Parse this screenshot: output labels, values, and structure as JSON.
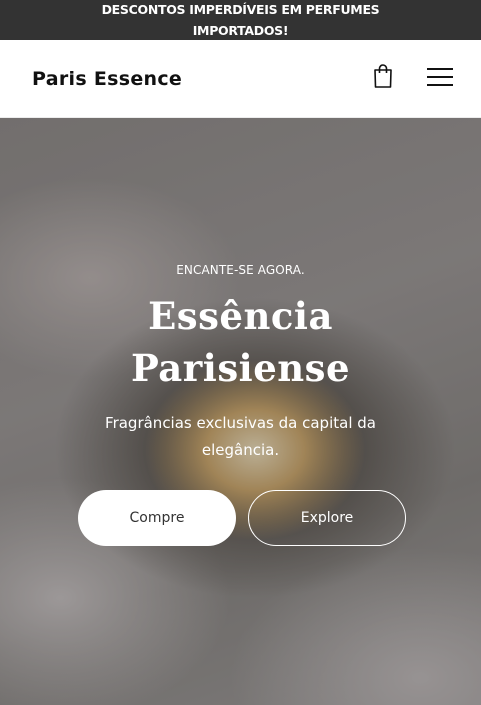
{
  "announcement": {
    "text": "DESCONTOS IMPERDÍVEIS EM PERFUMES IMPORTADOS!"
  },
  "header": {
    "logo_text": "Paris Essence",
    "cart_icon": "shopping-bag-icon",
    "menu_icon": "hamburger-menu-icon"
  },
  "hero": {
    "eyebrow": "ENCANTE-SE AGORA.",
    "title": "Essência Parisiense",
    "subtitle": "Fragrâncias exclusivas da capital da elegância.",
    "primary_button": "Compre",
    "secondary_button": "Explore"
  },
  "colors": {
    "announcement_bg": "#333333",
    "header_bg": "#ffffff",
    "text_dark": "#111111",
    "button_light": "#ffffff"
  }
}
